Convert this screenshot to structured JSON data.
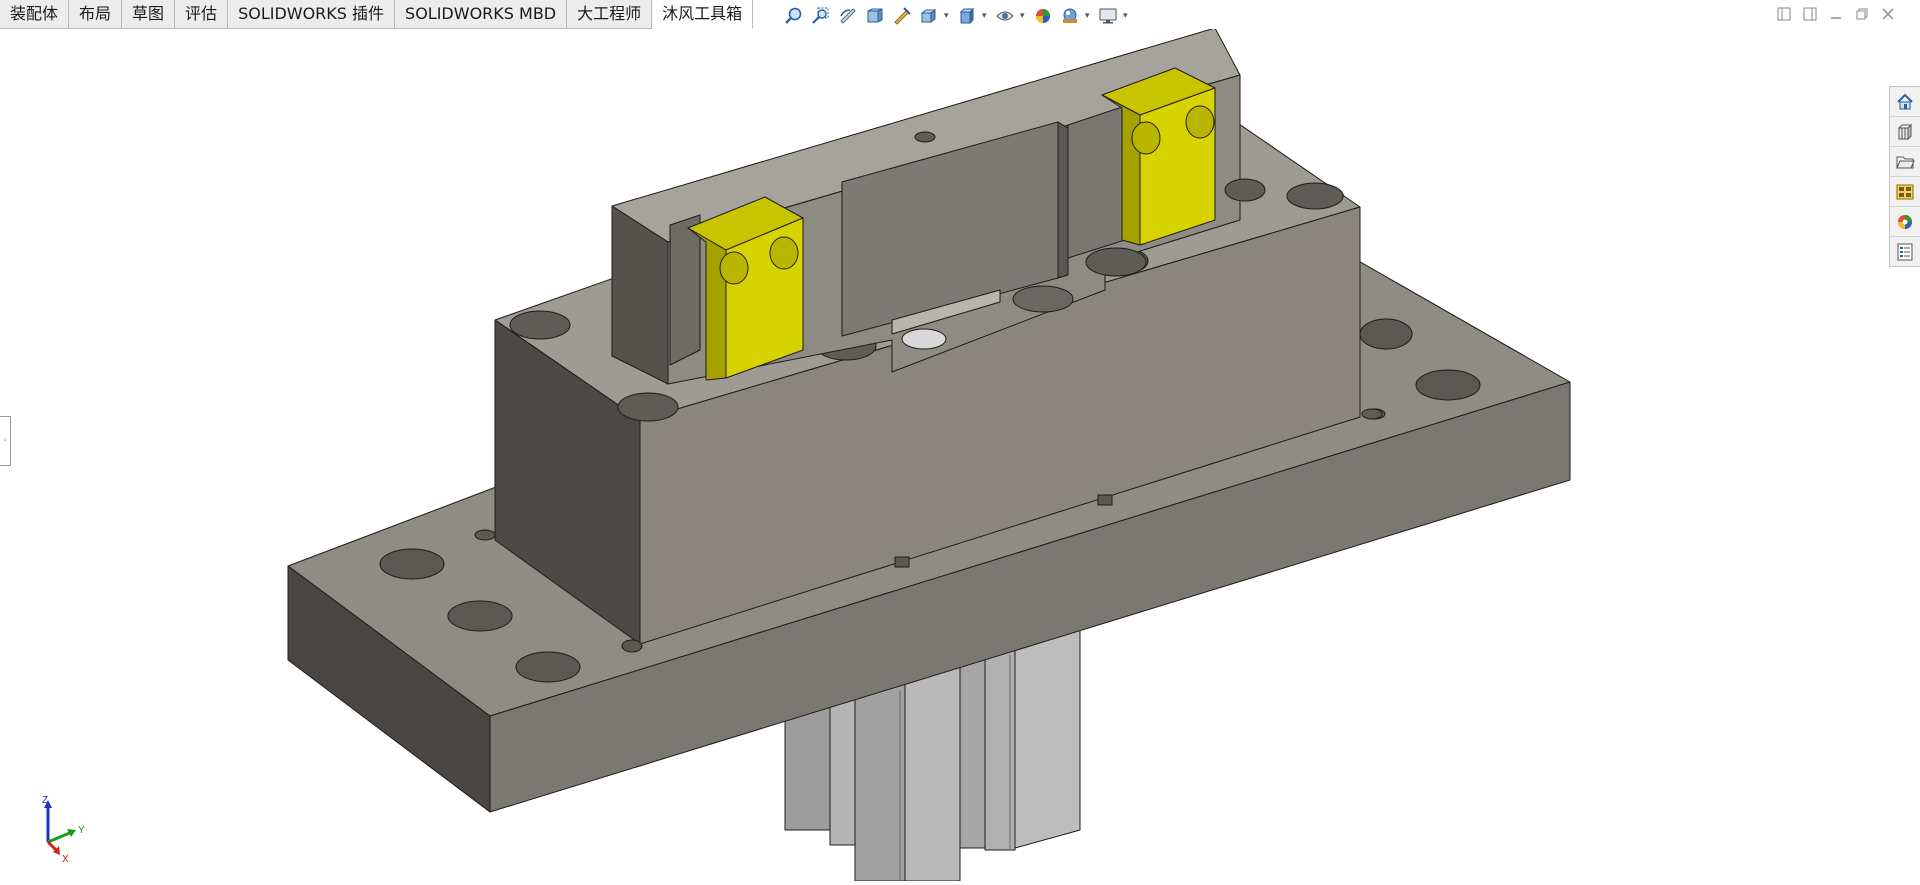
{
  "tabs": [
    {
      "label": "装配体",
      "active": false
    },
    {
      "label": "布局",
      "active": false
    },
    {
      "label": "草图",
      "active": false
    },
    {
      "label": "评估",
      "active": false
    },
    {
      "label": "SOLIDWORKS 插件",
      "active": false
    },
    {
      "label": "SOLIDWORKS MBD",
      "active": false
    },
    {
      "label": "大工程师",
      "active": false
    },
    {
      "label": "沐风工具箱",
      "active": true
    }
  ],
  "hud_toolbar": [
    {
      "icon": "zoom-to-fit-icon"
    },
    {
      "icon": "zoom-to-area-icon"
    },
    {
      "icon": "previous-view-icon"
    },
    {
      "icon": "section-view-icon"
    },
    {
      "icon": "dynamic-annotation-icon"
    },
    {
      "icon": "view-orientation-icon",
      "dropdown": true
    },
    {
      "icon": "display-style-icon",
      "dropdown": true
    },
    {
      "icon": "hide-show-items-icon",
      "dropdown": true
    },
    {
      "icon": "edit-appearance-icon"
    },
    {
      "icon": "apply-scene-icon",
      "dropdown": true
    },
    {
      "icon": "view-settings-icon",
      "dropdown": true
    }
  ],
  "window_controls": {
    "icons": [
      "tile-left-icon",
      "tile-right-icon",
      "minimize-icon",
      "restore-icon",
      "close-icon"
    ]
  },
  "task_pane": [
    {
      "icon": "solidworks-resources-icon"
    },
    {
      "icon": "design-library-icon"
    },
    {
      "icon": "file-explorer-icon"
    },
    {
      "icon": "view-palette-icon"
    },
    {
      "icon": "appearances-scenes-icon"
    },
    {
      "icon": "custom-properties-icon"
    }
  ],
  "triad": {
    "x_label": "X",
    "y_label": "Y",
    "z_label": "Z"
  },
  "colors": {
    "model_gray": "#8a8680",
    "model_dark": "#4a4643",
    "model_top": "#a09c96",
    "brass": "#d4d000",
    "rod_light": "#bdbdbd",
    "axis_x": "#d02020",
    "axis_y": "#1a9a1a",
    "axis_z": "#2030c0"
  }
}
